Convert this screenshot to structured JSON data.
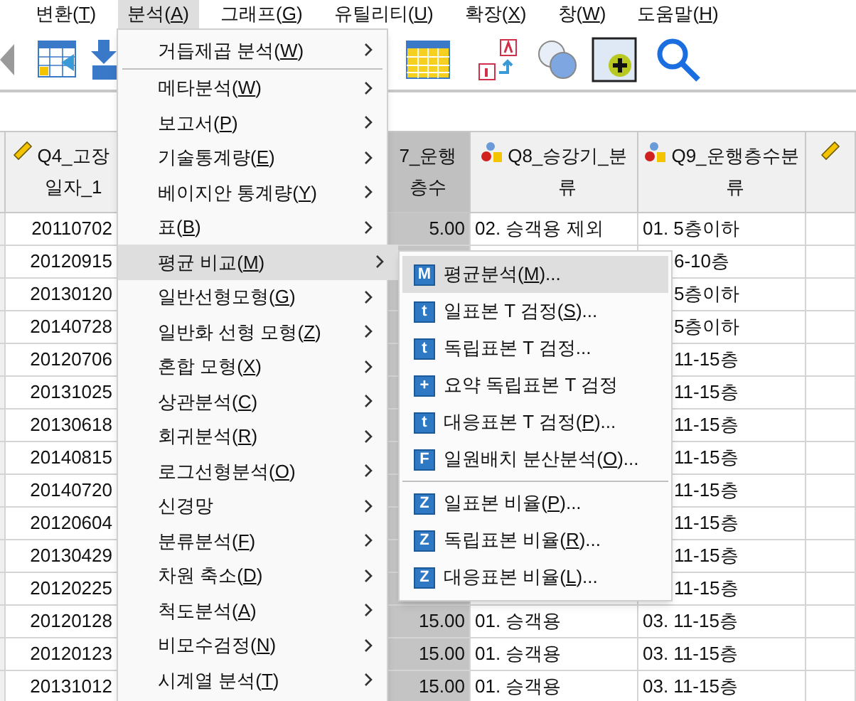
{
  "menubar": [
    {
      "label": "변환(T)",
      "selected": false
    },
    {
      "label": "분석(A)",
      "selected": true
    },
    {
      "label": "그래프(G)",
      "selected": false
    },
    {
      "label": "유틸리티(U)",
      "selected": false
    },
    {
      "label": "확장(X)",
      "selected": false
    },
    {
      "label": "창(W)",
      "selected": false
    },
    {
      "label": "도움말(H)",
      "selected": false
    }
  ],
  "columns": [
    {
      "lines": [
        "Q4_고장",
        "일자_1"
      ],
      "kind": "scale",
      "selected": false
    },
    {
      "lines": [
        "7_운행",
        "층수"
      ],
      "kind": "plain",
      "selected": true
    },
    {
      "lines": [
        "Q8_승강기_분",
        "류"
      ],
      "kind": "nominal",
      "selected": false
    },
    {
      "lines": [
        "Q9_운행층수분",
        "류"
      ],
      "kind": "nominal",
      "selected": false
    },
    {
      "kind": "scale",
      "selected": false
    }
  ],
  "rows": [
    {
      "cells": [
        "20110702",
        "5.00",
        "02. 승객용 제외",
        {
          "text": "01. 5층이하",
          "clipped": false
        }
      ]
    },
    {
      "cells": [
        "20120915",
        null,
        null,
        {
          "text": "6-10층",
          "clipped": true
        }
      ]
    },
    {
      "cells": [
        "20130120",
        null,
        null,
        {
          "text": "5층이하",
          "clipped": true
        }
      ]
    },
    {
      "cells": [
        "20140728",
        null,
        null,
        {
          "text": "5층이하",
          "clipped": true
        }
      ]
    },
    {
      "cells": [
        "20120706",
        null,
        null,
        {
          "text": "11-15층",
          "clipped": true
        }
      ]
    },
    {
      "cells": [
        "20131025",
        null,
        null,
        {
          "text": "11-15층",
          "clipped": true
        }
      ]
    },
    {
      "cells": [
        "20130618",
        null,
        null,
        {
          "text": "11-15층",
          "clipped": true
        }
      ]
    },
    {
      "cells": [
        "20140815",
        null,
        null,
        {
          "text": "11-15층",
          "clipped": true
        }
      ]
    },
    {
      "cells": [
        "20140720",
        null,
        null,
        {
          "text": "11-15층",
          "clipped": true
        }
      ]
    },
    {
      "cells": [
        "20120604",
        null,
        null,
        {
          "text": "11-15층",
          "clipped": true
        }
      ]
    },
    {
      "cells": [
        "20130429",
        null,
        null,
        {
          "text": "11-15층",
          "clipped": true
        }
      ]
    },
    {
      "cells": [
        "20120225",
        null,
        null,
        {
          "text": "11-15층",
          "clipped": true
        }
      ]
    },
    {
      "cells": [
        "20120128",
        "15.00",
        "01. 승객용",
        {
          "text": "03. 11-15층",
          "clipped": false
        }
      ]
    },
    {
      "cells": [
        "20120123",
        "15.00",
        "01. 승객용",
        {
          "text": "03. 11-15층",
          "clipped": false
        }
      ]
    },
    {
      "cells": [
        "20131012",
        "15.00",
        "01. 승객용",
        {
          "text": "03. 11-15층",
          "clipped": false
        }
      ]
    }
  ],
  "analyze_menu": [
    {
      "kind": "item",
      "label": "거듭제곱 분석(W)",
      "selected": false
    },
    {
      "kind": "separator"
    },
    {
      "kind": "item",
      "label": "메타분석(W)",
      "selected": false
    },
    {
      "kind": "item",
      "label": "보고서(P)",
      "selected": false
    },
    {
      "kind": "item",
      "label": "기술통계량(E)",
      "selected": false
    },
    {
      "kind": "item",
      "label": "베이지안 통계량(Y)",
      "selected": false
    },
    {
      "kind": "item",
      "label": "표(B)",
      "selected": false
    },
    {
      "kind": "item",
      "label": "평균 비교(M)",
      "selected": true
    },
    {
      "kind": "item",
      "label": "일반선형모형(G)",
      "selected": false
    },
    {
      "kind": "item",
      "label": "일반화 선형 모형(Z)",
      "selected": false
    },
    {
      "kind": "item",
      "label": "혼합 모형(X)",
      "selected": false
    },
    {
      "kind": "item",
      "label": "상관분석(C)",
      "selected": false
    },
    {
      "kind": "item",
      "label": "회귀분석(R)",
      "selected": false
    },
    {
      "kind": "item",
      "label": "로그선형분석(O)",
      "selected": false
    },
    {
      "kind": "item",
      "label": "신경망",
      "selected": false
    },
    {
      "kind": "item",
      "label": "분류분석(F)",
      "selected": false
    },
    {
      "kind": "item",
      "label": "차원 축소(D)",
      "selected": false
    },
    {
      "kind": "item",
      "label": "척도분석(A)",
      "selected": false
    },
    {
      "kind": "item",
      "label": "비모수검정(N)",
      "selected": false
    },
    {
      "kind": "item",
      "label": "시계열 분석(T)",
      "selected": false
    }
  ],
  "compare_means_menu": [
    {
      "kind": "item",
      "badge": "M",
      "label": "평균분석(M)...",
      "selected": true
    },
    {
      "kind": "item",
      "badge": "t",
      "label": "일표본 T 검정(S)...",
      "selected": false
    },
    {
      "kind": "item",
      "badge": "t",
      "label": "독립표본 T 검정...",
      "selected": false
    },
    {
      "kind": "item",
      "badge": "+",
      "label": "요약 독립표본 T 검정",
      "selected": false
    },
    {
      "kind": "item",
      "badge": "t",
      "label": "대응표본 T 검정(P)...",
      "selected": false
    },
    {
      "kind": "item",
      "badge": "F",
      "label": "일원배치 분산분석(O)...",
      "selected": false
    },
    {
      "kind": "separator"
    },
    {
      "kind": "item",
      "badge": "Z",
      "label": "일표본 비율(P)...",
      "selected": false
    },
    {
      "kind": "item",
      "badge": "Z",
      "label": "독립표본 비율(R)...",
      "selected": false
    },
    {
      "kind": "item",
      "badge": "Z",
      "label": "대응표본 비율(L)...",
      "selected": false
    }
  ]
}
